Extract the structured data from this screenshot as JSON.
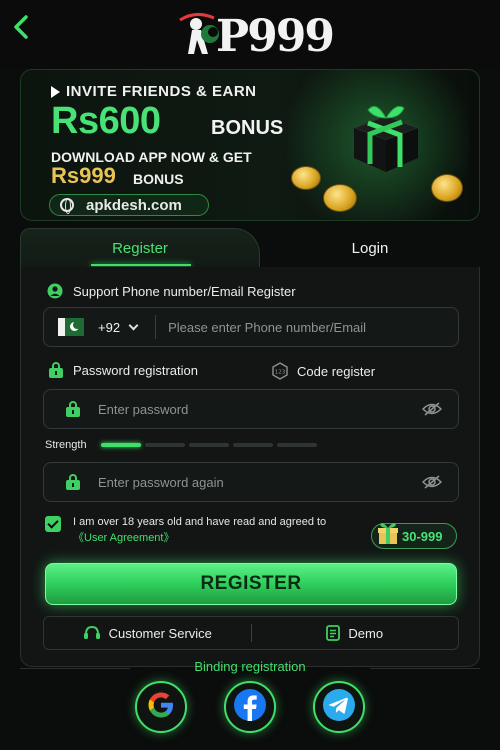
{
  "header": {
    "logo_text": "P999"
  },
  "banner": {
    "line1": "INVITE FRIENDS & EARN",
    "amount": "Rs600",
    "amount_suffix": "BONUS",
    "line2": "DOWNLOAD APP NOW & GET",
    "amount2": "Rs999",
    "amount2_suffix": "BONUS",
    "url": "apkdesh.com"
  },
  "tabs": [
    {
      "label": "Register",
      "active": true
    },
    {
      "label": "Login",
      "active": false
    }
  ],
  "form": {
    "phone_section_label": "Support Phone number/Email Register",
    "country_code": "+92",
    "phone_placeholder": "Please enter Phone number/Email",
    "password_reg_label": "Password registration",
    "code_reg_label": "Code register",
    "password_placeholder": "Enter password",
    "strength_label": "Strength",
    "strength_level": 1,
    "strength_segments": 5,
    "password_again_placeholder": "Enter password again",
    "agree_text": "I am over 18 years old and have read and agreed to",
    "agree_link": "《User Agreement》",
    "agree_checked": true,
    "reward_label": "30-999",
    "register_button": "REGISTER"
  },
  "service_bar": {
    "customer_service": "Customer Service",
    "demo": "Demo"
  },
  "binding": {
    "label": "Binding registration",
    "providers": [
      "google-icon",
      "facebook-icon",
      "telegram-icon"
    ]
  },
  "colors": {
    "accent": "#3fe06a",
    "gold": "#e9c455",
    "background": "#0b0d0c"
  }
}
